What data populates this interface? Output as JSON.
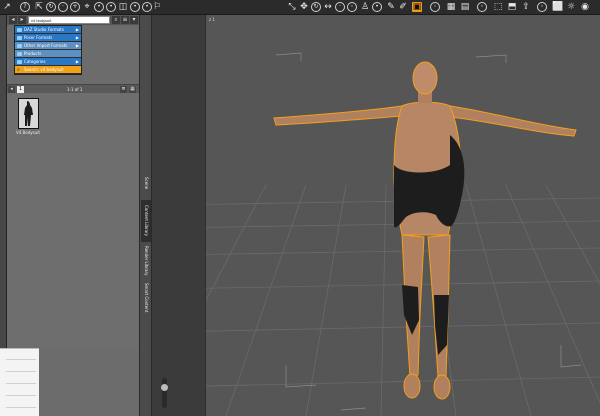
{
  "search": {
    "value": "v4 bodysuit"
  },
  "menu": {
    "items": [
      {
        "label": "DAZ Studio Formats",
        "style": "blue",
        "arrow": "▶"
      },
      {
        "label": "Poser Formats",
        "style": "blue",
        "arrow": "▶"
      },
      {
        "label": "Other Import Formats",
        "style": "grey",
        "arrow": "▶"
      },
      {
        "label": "Products",
        "style": "grey",
        "arrow": ""
      },
      {
        "label": "Categories",
        "style": "blue",
        "arrow": "▶"
      },
      {
        "label": "Search: v4 bodysuit",
        "style": "orange",
        "arrow": ""
      }
    ]
  },
  "pager": {
    "page": "1",
    "range": "1-1 of 1"
  },
  "results": [
    {
      "label": "V4 Bodysuit"
    }
  ],
  "tabs": {
    "scene": "Scene",
    "content_library": "Content Library",
    "render_library": "Render Library",
    "smart_content": "Smart Content"
  },
  "viewport": {
    "label": "z 1"
  },
  "slider": {
    "value_label": "Auto"
  },
  "colors": {
    "accent": "#f29a1e",
    "selection_blue": "#2a77c6",
    "outline": "#f4a01c"
  }
}
